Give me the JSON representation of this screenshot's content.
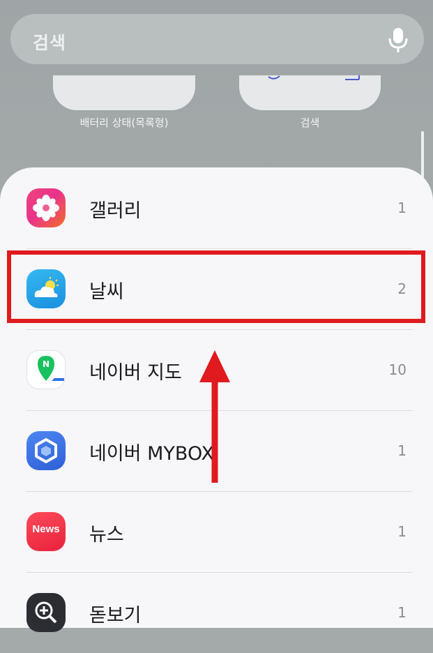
{
  "search": {
    "placeholder": "검색"
  },
  "widgets": [
    {
      "label": "배터리 상태(목록형)"
    },
    {
      "label": "검색"
    }
  ],
  "apps": [
    {
      "name": "갤러리",
      "count": "1",
      "icon": "gallery-icon"
    },
    {
      "name": "날씨",
      "count": "2",
      "icon": "weather-icon"
    },
    {
      "name": "네이버 지도",
      "count": "10",
      "icon": "naver-map-icon"
    },
    {
      "name": "네이버 MYBOX",
      "count": "1",
      "icon": "naver-mybox-icon"
    },
    {
      "name": "뉴스",
      "count": "1",
      "icon": "news-icon",
      "icon_text": "News"
    },
    {
      "name": "돋보기",
      "count": "1",
      "icon": "magnifier-icon"
    }
  ],
  "annotation": {
    "highlight_color": "#e01a1f",
    "arrow_color": "#e01a1f"
  }
}
